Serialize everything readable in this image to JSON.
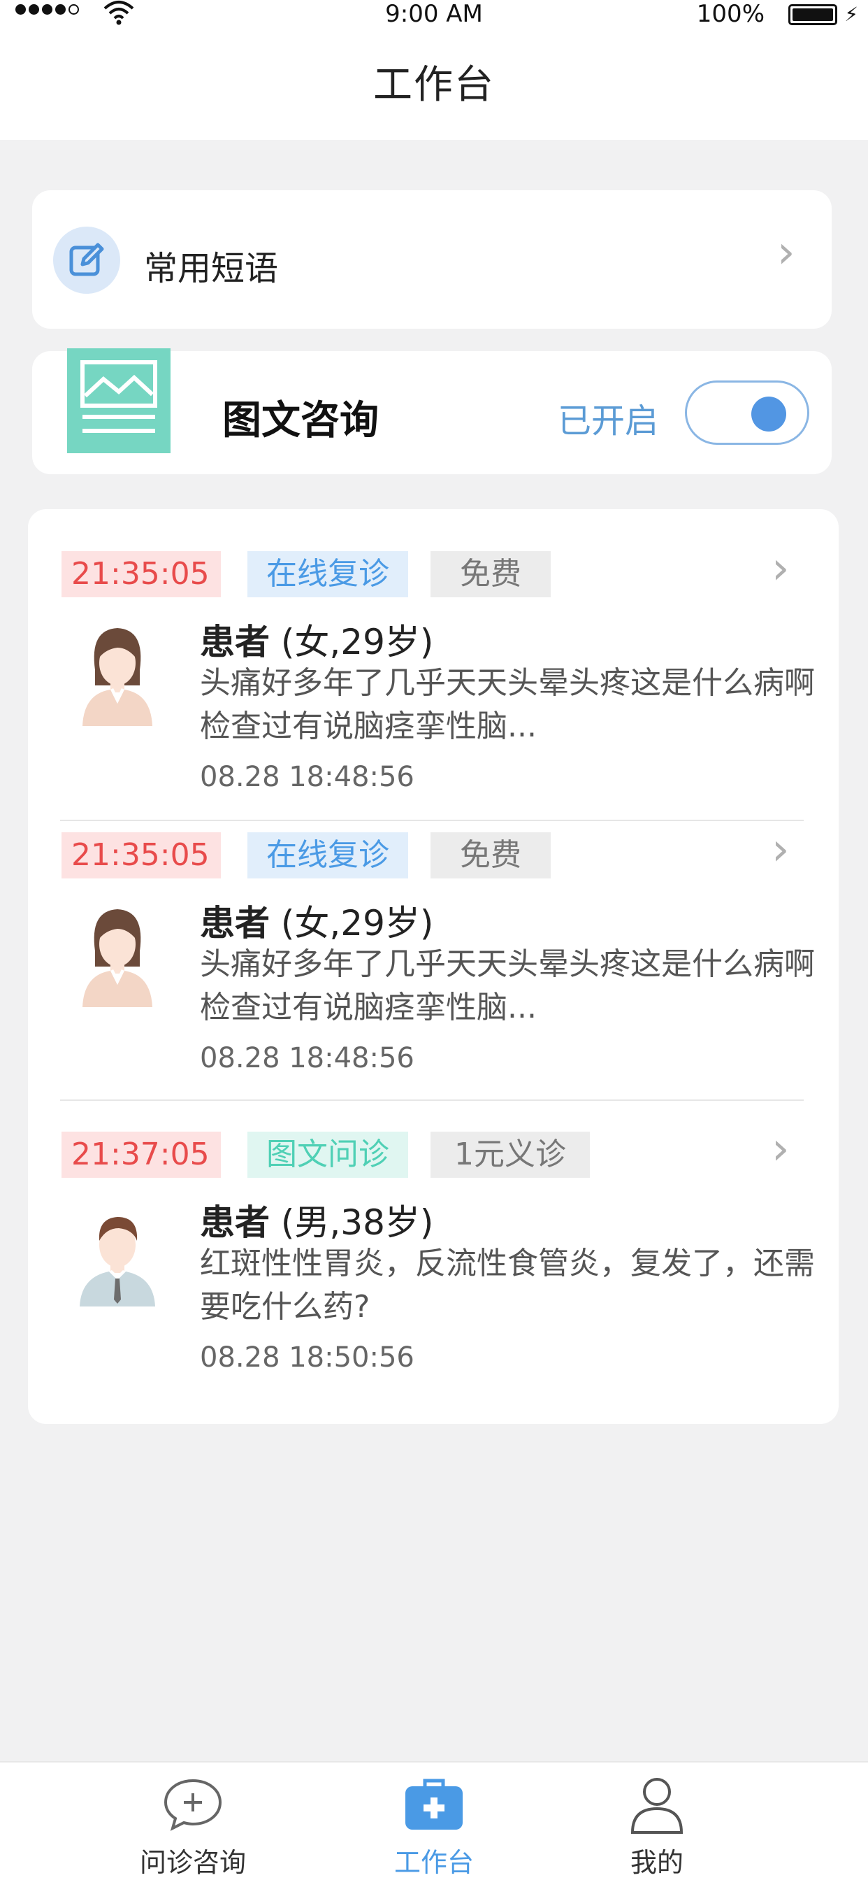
{
  "status_bar": {
    "time": "9:00 AM",
    "battery": "100%"
  },
  "header": {
    "title": "工作台"
  },
  "phrases": {
    "label": "常用短语",
    "icon": "edit-icon"
  },
  "consult": {
    "label": "图文咨询",
    "status": "已开启",
    "toggle_on": true
  },
  "items": [
    {
      "time": "21:35:05",
      "type": "在线复诊",
      "fee": "免费",
      "patient_name": "患者",
      "patient_info": "(女,29岁)",
      "message": "头痛好多年了几乎天天头晕头疼这是什么病啊检查过有说脑痉挛性脑...",
      "timestamp": "08.28 18:48:56",
      "avatar": "female-doctor-avatar"
    },
    {
      "time": "21:35:05",
      "type": "在线复诊",
      "fee": "免费",
      "patient_name": "患者",
      "patient_info": "(女,29岁)",
      "message": "头痛好多年了几乎天天头晕头疼这是什么病啊检查过有说脑痉挛性脑...",
      "timestamp": "08.28 18:48:56",
      "avatar": "female-doctor-avatar"
    },
    {
      "time": "21:37:05",
      "type": "图文问诊",
      "fee": "1元义诊",
      "patient_name": "患者",
      "patient_info": "(男,38岁)",
      "message": "红斑性性胃炎，反流性食管炎，复发了，还需要吃什么药?",
      "timestamp": "08.28 18:50:56",
      "avatar": "male-avatar"
    }
  ],
  "tabbar": {
    "tabs": [
      {
        "label": "问诊咨询",
        "icon": "chat-plus-icon",
        "active": false
      },
      {
        "label": "工作台",
        "icon": "medical-kit-icon",
        "active": true
      },
      {
        "label": "我的",
        "icon": "user-icon",
        "active": false
      }
    ]
  },
  "colors": {
    "accent_blue": "#4a9ae5",
    "time_red": "#e84b4b",
    "green": "#4fd0b5",
    "background": "#f1f1f2"
  }
}
